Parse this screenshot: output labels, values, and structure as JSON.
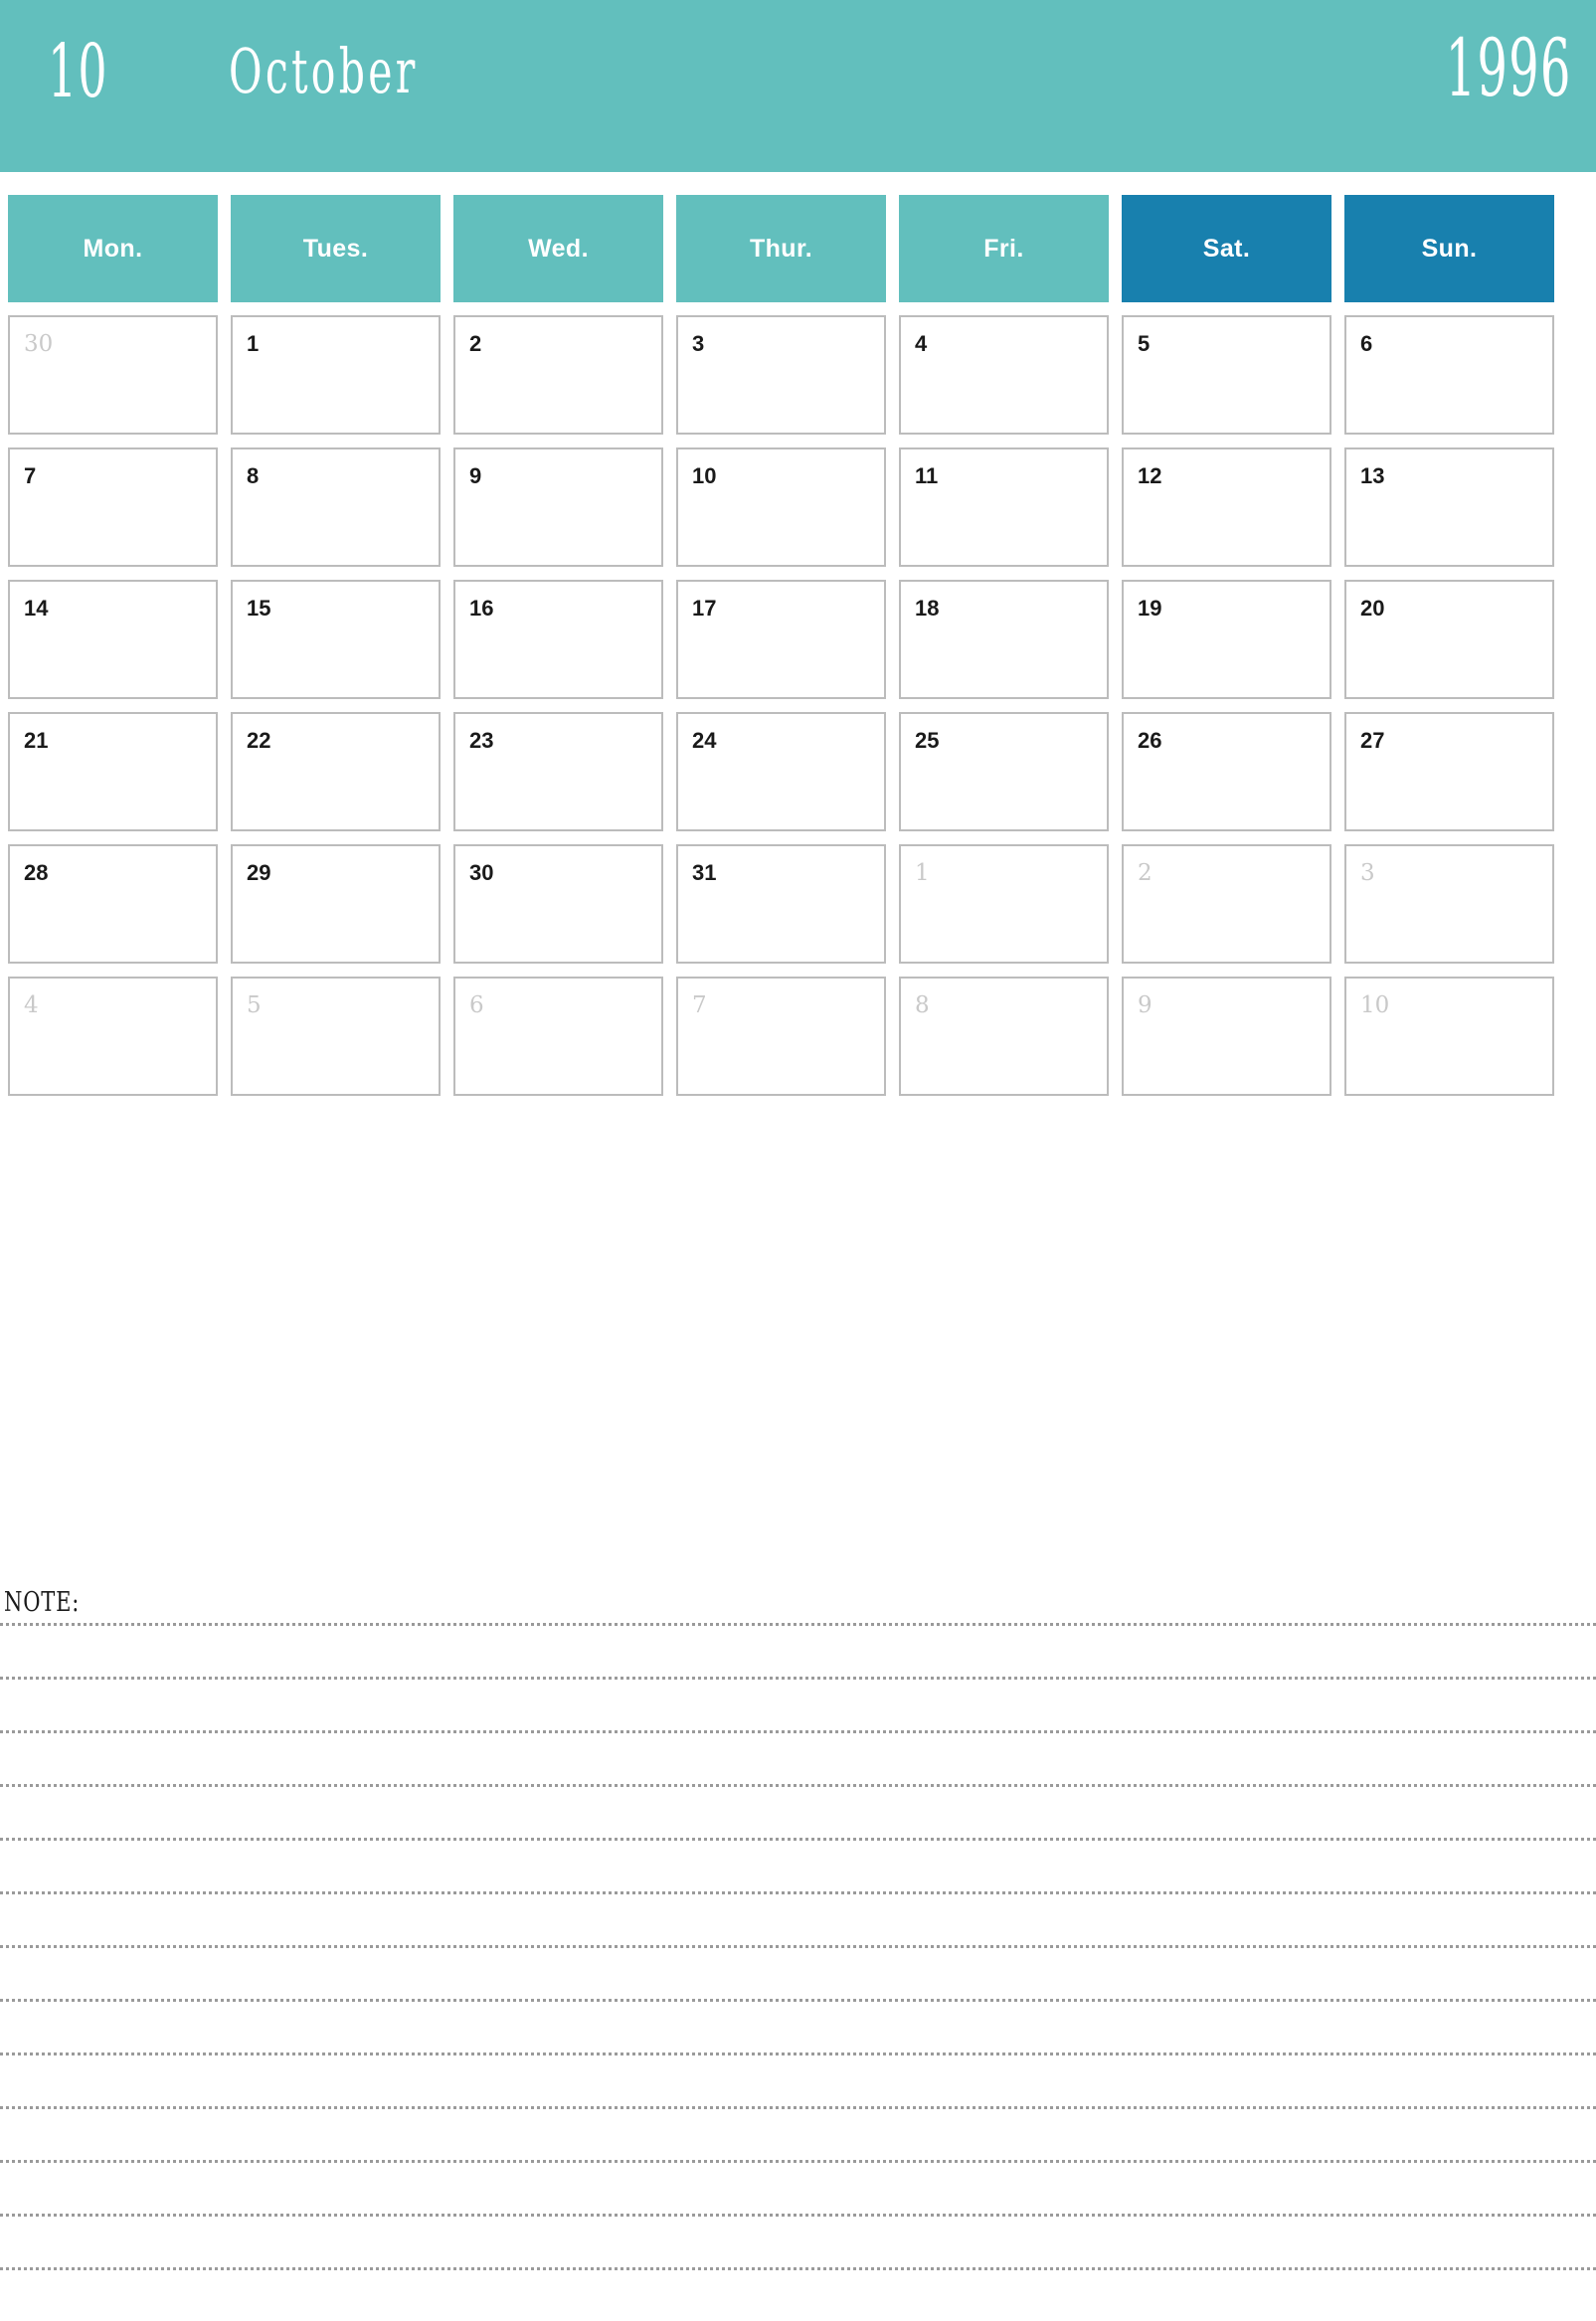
{
  "header": {
    "month_number": "10",
    "month_name": "October",
    "year": "1996",
    "background_color": "#62bfbd",
    "text_color": "#ffffff"
  },
  "weekdays": [
    {
      "label": "Mon.",
      "weekend": false
    },
    {
      "label": "Tues.",
      "weekend": false
    },
    {
      "label": "Wed.",
      "weekend": false
    },
    {
      "label": "Thur.",
      "weekend": false
    },
    {
      "label": "Fri.",
      "weekend": false
    },
    {
      "label": "Sat.",
      "weekend": true
    },
    {
      "label": "Sun.",
      "weekend": true
    }
  ],
  "colors": {
    "weekday_teal": "#62bfbd",
    "weekend_blue": "#1880ae",
    "cell_border": "#bcbcbc",
    "current_month_text": "#1a1a1a",
    "other_month_text": "#c9c9c9"
  },
  "weeks": [
    [
      {
        "num": "30",
        "current": false
      },
      {
        "num": "1",
        "current": true
      },
      {
        "num": "2",
        "current": true
      },
      {
        "num": "3",
        "current": true
      },
      {
        "num": "4",
        "current": true
      },
      {
        "num": "5",
        "current": true
      },
      {
        "num": "6",
        "current": true
      }
    ],
    [
      {
        "num": "7",
        "current": true
      },
      {
        "num": "8",
        "current": true
      },
      {
        "num": "9",
        "current": true
      },
      {
        "num": "10",
        "current": true
      },
      {
        "num": "11",
        "current": true
      },
      {
        "num": "12",
        "current": true
      },
      {
        "num": "13",
        "current": true
      }
    ],
    [
      {
        "num": "14",
        "current": true
      },
      {
        "num": "15",
        "current": true
      },
      {
        "num": "16",
        "current": true
      },
      {
        "num": "17",
        "current": true
      },
      {
        "num": "18",
        "current": true
      },
      {
        "num": "19",
        "current": true
      },
      {
        "num": "20",
        "current": true
      }
    ],
    [
      {
        "num": "21",
        "current": true
      },
      {
        "num": "22",
        "current": true
      },
      {
        "num": "23",
        "current": true
      },
      {
        "num": "24",
        "current": true
      },
      {
        "num": "25",
        "current": true
      },
      {
        "num": "26",
        "current": true
      },
      {
        "num": "27",
        "current": true
      }
    ],
    [
      {
        "num": "28",
        "current": true
      },
      {
        "num": "29",
        "current": true
      },
      {
        "num": "30",
        "current": true
      },
      {
        "num": "31",
        "current": true
      },
      {
        "num": "1",
        "current": false
      },
      {
        "num": "2",
        "current": false
      },
      {
        "num": "3",
        "current": false
      }
    ],
    [
      {
        "num": "4",
        "current": false
      },
      {
        "num": "5",
        "current": false
      },
      {
        "num": "6",
        "current": false
      },
      {
        "num": "7",
        "current": false
      },
      {
        "num": "8",
        "current": false
      },
      {
        "num": "9",
        "current": false
      },
      {
        "num": "10",
        "current": false
      }
    ]
  ],
  "note": {
    "label": "NOTE:",
    "line_count": 13
  }
}
